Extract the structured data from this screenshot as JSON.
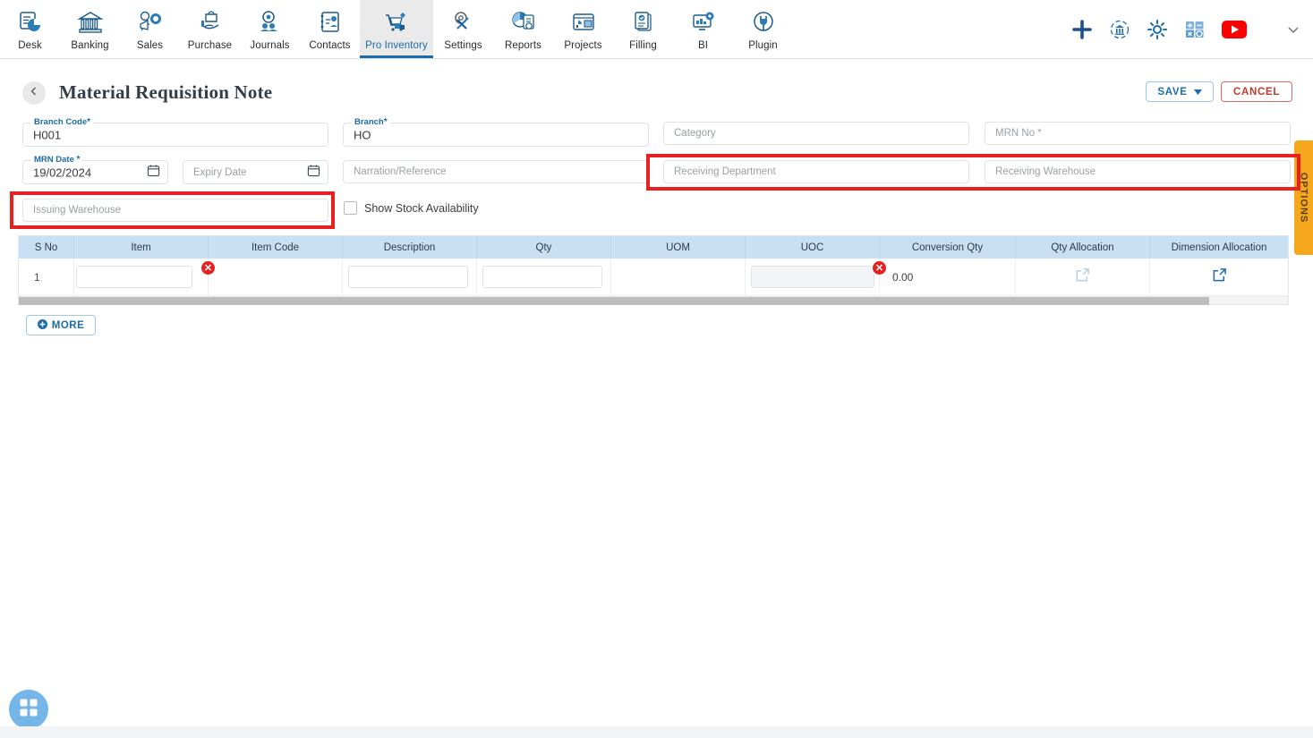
{
  "topnav": {
    "items": [
      {
        "label": "Desk",
        "icon": "desk-dashboard-icon"
      },
      {
        "label": "Banking",
        "icon": "bank-building-icon"
      },
      {
        "label": "Sales",
        "icon": "sales-megaphone-icon"
      },
      {
        "label": "Purchase",
        "icon": "purchase-hand-bag-icon"
      },
      {
        "label": "Journals",
        "icon": "journals-gear-people-icon"
      },
      {
        "label": "Contacts",
        "icon": "contacts-book-icon"
      },
      {
        "label": "Pro Inventory",
        "icon": "inventory-cart-icon",
        "active": true
      },
      {
        "label": "Settings",
        "icon": "settings-tools-icon"
      },
      {
        "label": "Reports",
        "icon": "reports-piechart-icon"
      },
      {
        "label": "Projects",
        "icon": "projects-board-icon"
      },
      {
        "label": "Filling",
        "icon": "filling-documents-icon"
      },
      {
        "label": "BI",
        "icon": "bi-monitor-icon"
      },
      {
        "label": "Plugin",
        "icon": "plugin-plug-icon"
      }
    ],
    "right_icons": [
      {
        "icon": "plus-add-icon",
        "color": "#1a4f91"
      },
      {
        "icon": "company-switch-icon",
        "color": "#1b6ca8"
      },
      {
        "icon": "gear-settings-icon",
        "color": "#1b6ca8"
      },
      {
        "icon": "calculator-icon",
        "color": "#5b9bd5"
      },
      {
        "icon": "youtube-icon",
        "color": "#ff0000"
      },
      {
        "icon": "chevron-down-icon",
        "color": "#6b7178"
      }
    ]
  },
  "header": {
    "back_icon": "chevron-left-icon",
    "title": "Material Requisition Note",
    "save_label": "SAVE",
    "save_caret_icon": "caret-down-icon",
    "cancel_label": "CANCEL"
  },
  "form": {
    "branch_code": {
      "label": "Branch Code",
      "required": "*",
      "value": "H001"
    },
    "branch": {
      "label": "Branch",
      "required": "*",
      "value": "HO"
    },
    "category": {
      "placeholder": "Category"
    },
    "mrn_no": {
      "placeholder": "MRN No",
      "required": "*"
    },
    "mrn_date": {
      "label": "MRN Date",
      "required": "*",
      "value": "19/02/2024",
      "icon": "calendar-icon"
    },
    "expiry_date": {
      "placeholder": "Expiry Date",
      "icon": "calendar-icon"
    },
    "narration": {
      "placeholder": "Narration/Reference"
    },
    "receiving_department": {
      "placeholder": "Receiving Department"
    },
    "receiving_warehouse": {
      "placeholder": "Receiving Warehouse"
    },
    "issuing_warehouse": {
      "placeholder": "Issuing Warehouse"
    },
    "show_stock": {
      "label": "Show Stock Availability",
      "checked": false
    }
  },
  "grid": {
    "columns": [
      "S No",
      "Item",
      "Item Code",
      "Description",
      "Qty",
      "UOM",
      "UOC",
      "Conversion Qty",
      "Qty Allocation",
      "Dimension Allocation"
    ],
    "rows": [
      {
        "s_no": "1",
        "item": "",
        "item_code": "",
        "description": "",
        "qty": "",
        "uom": "",
        "uoc": "",
        "conversion_qty": "0.00",
        "qty_allocation_icon": "external-link-icon",
        "dimension_allocation_icon": "external-link-icon"
      }
    ],
    "error_badges": [
      "item-required-error",
      "uoc-required-error"
    ],
    "error_glyph": "✕"
  },
  "more_button": {
    "label": "MORE",
    "icon": "plus-circle-icon"
  },
  "options_tab": {
    "label": "OPTIONS"
  },
  "fab": {
    "icon": "grid-apps-icon"
  },
  "colors": {
    "accent_blue": "#1b6ca8",
    "header_blue": "#c8e0f4",
    "error_red": "#e52222",
    "highlight_red": "#e8201f",
    "options_orange": "#f5a81c",
    "cancel_red": "#c0392b",
    "fab_blue": "#74b6e8"
  }
}
